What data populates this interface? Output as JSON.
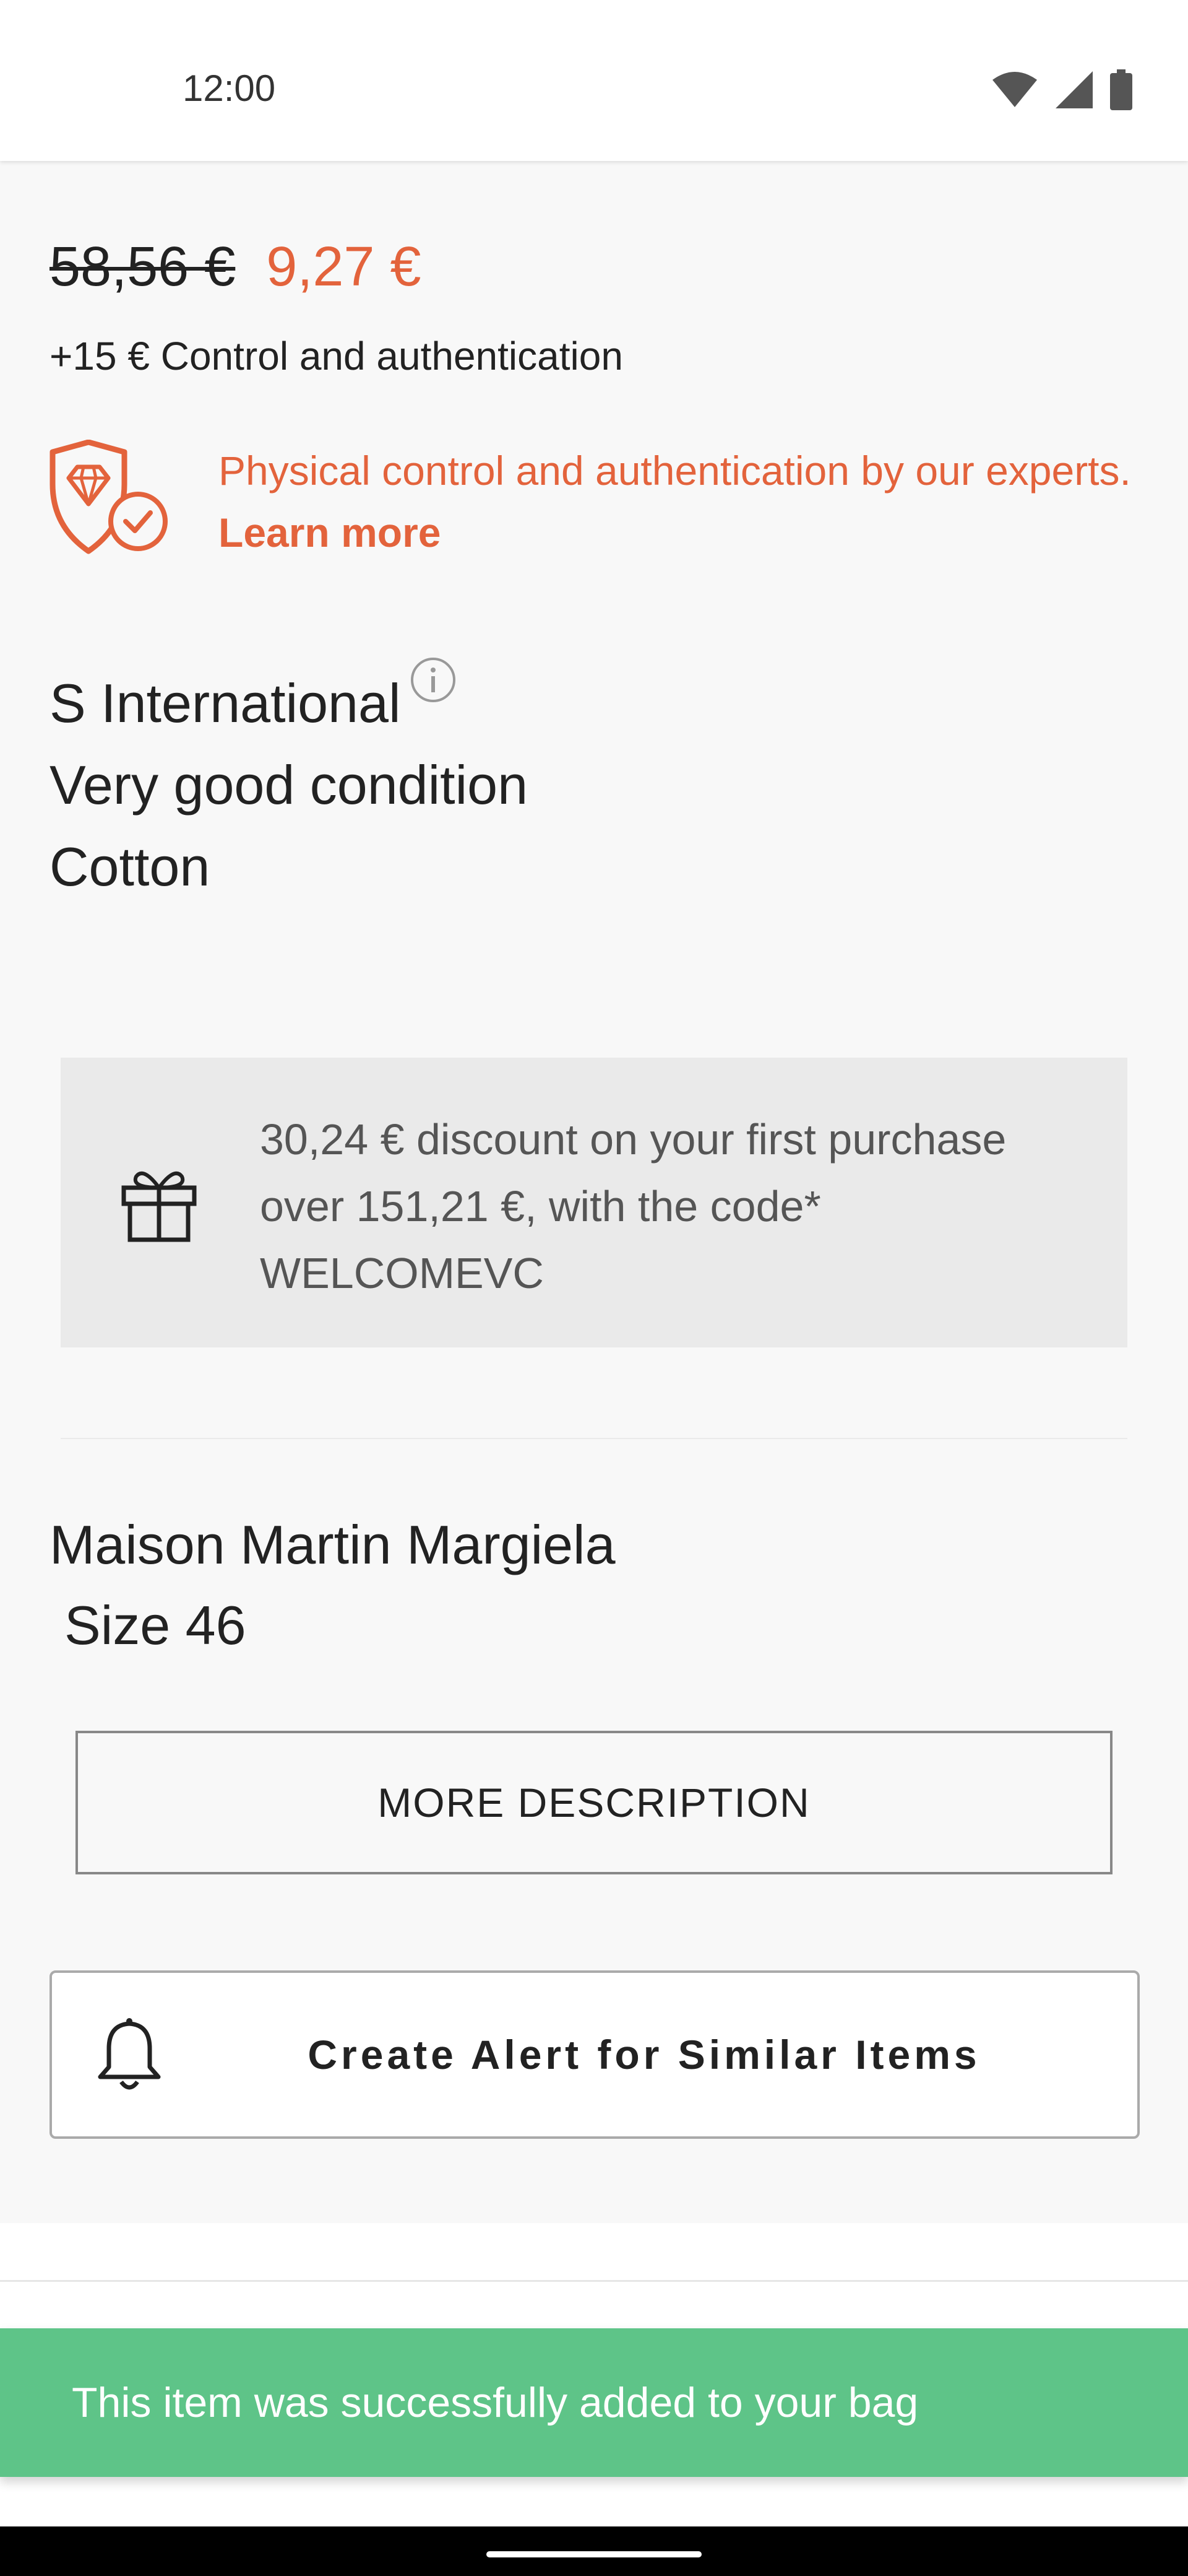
{
  "status_bar": {
    "time": "12:00",
    "icons": [
      "wifi-icon",
      "signal-icon",
      "battery-icon"
    ]
  },
  "pricing": {
    "original_price": "58,56 €",
    "sale_price": "9,27 €",
    "fee_line": "+15 € Control and authentication"
  },
  "authentication": {
    "icon": "diamond-shield-check-icon",
    "text": "Physical control and authentication by our experts.",
    "link": "Learn more"
  },
  "attributes": {
    "size": "S International",
    "condition": "Very good condition",
    "material": "Cotton"
  },
  "promo": {
    "icon": "gift-icon",
    "text": "30,24 € discount on your first purchase over 151,21 €, with the code* WELCOMEVC"
  },
  "product": {
    "brand": "Maison Martin Margiela",
    "size": "Size 46"
  },
  "buttons": {
    "more_description": "MORE DESCRIPTION",
    "create_alert": "Create Alert for Similar Items"
  },
  "toast": {
    "message": "This item was successfully added to your bag"
  },
  "colors": {
    "accent": "#e3633c",
    "toast_bg": "#5ec488",
    "promo_bg": "#eaeaea",
    "content_bg": "#f8f8f8"
  }
}
